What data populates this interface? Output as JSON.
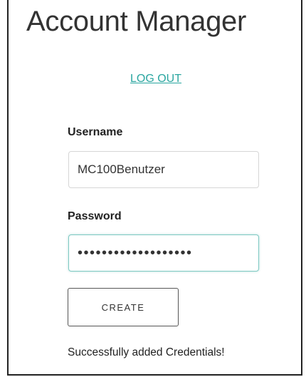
{
  "header": {
    "title": "Account Manager",
    "logout_label": "LOG OUT"
  },
  "form": {
    "username_label": "Username",
    "username_value": "MC100Benutzer",
    "password_label": "Password",
    "password_value": "•••••••••••••••••••",
    "create_label": "CREATE"
  },
  "status": {
    "message": "Successfully added Credentials!"
  },
  "colors": {
    "link": "#2aa6a0",
    "focus_border": "#7ec9c3"
  }
}
